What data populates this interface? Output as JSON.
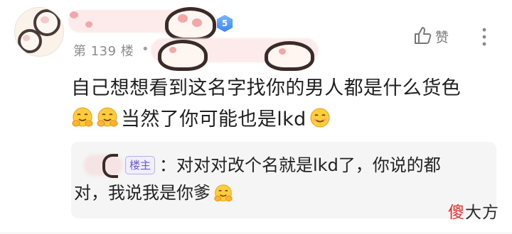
{
  "post": {
    "level": "5",
    "floor": "第 139 楼",
    "floor_separator": "•",
    "like_label": "赞"
  },
  "comment": {
    "line1": "自己想想看到这名字找你的男人都是什么货色",
    "line2": "当然了你可能也是lkd"
  },
  "reply": {
    "op_badge": "楼主",
    "line1": "：对对对改个名就是lkd了，你说的都",
    "line2": "对，我说我是你爹"
  },
  "watermark": {
    "part1": "傻",
    "part2": "大方"
  },
  "icons": {
    "like": "thumbs-up-icon",
    "more": "more-vertical-icon",
    "emoji": "hug-emoji-icon",
    "smile": "smile-emoji-icon"
  },
  "colors": {
    "badge_blue": "#3d84f5",
    "op_badge_purple": "#6b5bd2",
    "watermark_red": "#e0342b"
  }
}
